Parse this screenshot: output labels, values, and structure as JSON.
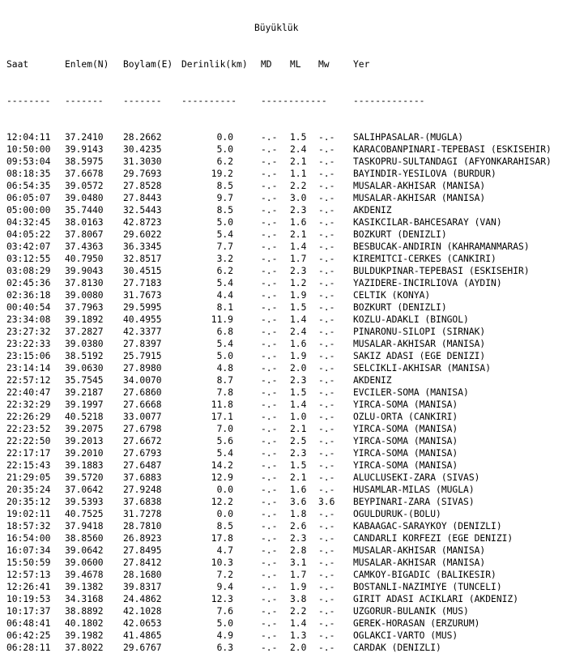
{
  "header": {
    "group_title": "Büyüklük",
    "columns": {
      "saat": "Saat",
      "enlem": "Enlem(N)",
      "boylam": "Boylam(E)",
      "derinlik": "Derinlik(km)",
      "md": "MD",
      "ml": "ML",
      "mw": "Mw",
      "yer": "Yer"
    },
    "dashes": {
      "saat": "--------",
      "enlem": "-------",
      "boylam": "-------",
      "derinlik": "----------",
      "mag": "------------",
      "yer": "-------------"
    }
  },
  "rows": [
    {
      "saat": "12:04:11",
      "enlem": "37.2410",
      "boylam": "28.2662",
      "derinlik": "0.0",
      "md": "-.-",
      "ml": "1.5",
      "mw": "-.-",
      "yer": "SALIHPASALAR-(MUGLA)"
    },
    {
      "saat": "10:50:00",
      "enlem": "39.9143",
      "boylam": "30.4235",
      "derinlik": "5.0",
      "md": "-.-",
      "ml": "2.4",
      "mw": "-.-",
      "yer": "KARACOBANPINARI-TEPEBASI (ESKISEHIR)"
    },
    {
      "saat": "09:53:04",
      "enlem": "38.5975",
      "boylam": "31.3030",
      "derinlik": "6.2",
      "md": "-.-",
      "ml": "2.1",
      "mw": "-.-",
      "yer": "TASKOPRU-SULTANDAGI (AFYONKARAHISAR)"
    },
    {
      "saat": "08:18:35",
      "enlem": "37.6678",
      "boylam": "29.7693",
      "derinlik": "19.2",
      "md": "-.-",
      "ml": "1.1",
      "mw": "-.-",
      "yer": "BAYINDIR-YESILOVA (BURDUR)"
    },
    {
      "saat": "06:54:35",
      "enlem": "39.0572",
      "boylam": "27.8528",
      "derinlik": "8.5",
      "md": "-.-",
      "ml": "2.2",
      "mw": "-.-",
      "yer": "MUSALAR-AKHISAR (MANISA)"
    },
    {
      "saat": "06:05:07",
      "enlem": "39.0480",
      "boylam": "27.8443",
      "derinlik": "9.7",
      "md": "-.-",
      "ml": "3.0",
      "mw": "-.-",
      "yer": "MUSALAR-AKHISAR (MANISA)"
    },
    {
      "saat": "05:00:00",
      "enlem": "35.7440",
      "boylam": "32.5443",
      "derinlik": "8.5",
      "md": "-.-",
      "ml": "2.3",
      "mw": "-.-",
      "yer": "AKDENIZ"
    },
    {
      "saat": "04:32:45",
      "enlem": "38.0163",
      "boylam": "42.8723",
      "derinlik": "5.0",
      "md": "-.-",
      "ml": "1.6",
      "mw": "-.-",
      "yer": "KASIKCILAR-BAHCESARAY (VAN)"
    },
    {
      "saat": "04:05:22",
      "enlem": "37.8067",
      "boylam": "29.6022",
      "derinlik": "5.4",
      "md": "-.-",
      "ml": "2.1",
      "mw": "-.-",
      "yer": "BOZKURT (DENIZLI)"
    },
    {
      "saat": "03:42:07",
      "enlem": "37.4363",
      "boylam": "36.3345",
      "derinlik": "7.7",
      "md": "-.-",
      "ml": "1.4",
      "mw": "-.-",
      "yer": "BESBUCAK-ANDIRIN (KAHRAMANMARAS)"
    },
    {
      "saat": "03:12:55",
      "enlem": "40.7950",
      "boylam": "32.8517",
      "derinlik": "3.2",
      "md": "-.-",
      "ml": "1.7",
      "mw": "-.-",
      "yer": "KIREMITCI-CERKES (CANKIRI)"
    },
    {
      "saat": "03:08:29",
      "enlem": "39.9043",
      "boylam": "30.4515",
      "derinlik": "6.2",
      "md": "-.-",
      "ml": "2.3",
      "mw": "-.-",
      "yer": "BULDUKPINAR-TEPEBASI (ESKISEHIR)"
    },
    {
      "saat": "02:45:36",
      "enlem": "37.8130",
      "boylam": "27.7183",
      "derinlik": "5.4",
      "md": "-.-",
      "ml": "1.2",
      "mw": "-.-",
      "yer": "YAZIDERE-INCIRLIOVA (AYDIN)"
    },
    {
      "saat": "02:36:18",
      "enlem": "39.0080",
      "boylam": "31.7673",
      "derinlik": "4.4",
      "md": "-.-",
      "ml": "1.9",
      "mw": "-.-",
      "yer": "CELTIK (KONYA)"
    },
    {
      "saat": "00:40:54",
      "enlem": "37.7963",
      "boylam": "29.5995",
      "derinlik": "8.1",
      "md": "-.-",
      "ml": "1.5",
      "mw": "-.-",
      "yer": "BOZKURT (DENIZLI)"
    },
    {
      "saat": "23:34:08",
      "enlem": "39.1892",
      "boylam": "40.4955",
      "derinlik": "11.9",
      "md": "-.-",
      "ml": "1.4",
      "mw": "-.-",
      "yer": "KOZLU-ADAKLI (BINGOL)"
    },
    {
      "saat": "23:27:32",
      "enlem": "37.2827",
      "boylam": "42.3377",
      "derinlik": "6.8",
      "md": "-.-",
      "ml": "2.4",
      "mw": "-.-",
      "yer": "PINARONU-SILOPI (SIRNAK)"
    },
    {
      "saat": "23:22:33",
      "enlem": "39.0380",
      "boylam": "27.8397",
      "derinlik": "5.4",
      "md": "-.-",
      "ml": "1.6",
      "mw": "-.-",
      "yer": "MUSALAR-AKHISAR (MANISA)"
    },
    {
      "saat": "23:15:06",
      "enlem": "38.5192",
      "boylam": "25.7915",
      "derinlik": "5.0",
      "md": "-.-",
      "ml": "1.9",
      "mw": "-.-",
      "yer": "SAKIZ ADASI (EGE DENIZI)"
    },
    {
      "saat": "23:14:14",
      "enlem": "39.0630",
      "boylam": "27.8980",
      "derinlik": "4.8",
      "md": "-.-",
      "ml": "2.0",
      "mw": "-.-",
      "yer": "SELCIKLI-AKHISAR (MANISA)"
    },
    {
      "saat": "22:57:12",
      "enlem": "35.7545",
      "boylam": "34.0070",
      "derinlik": "8.7",
      "md": "-.-",
      "ml": "2.3",
      "mw": "-.-",
      "yer": "AKDENIZ"
    },
    {
      "saat": "22:40:47",
      "enlem": "39.2187",
      "boylam": "27.6860",
      "derinlik": "7.8",
      "md": "-.-",
      "ml": "1.5",
      "mw": "-.-",
      "yer": "EVCILER-SOMA (MANISA)"
    },
    {
      "saat": "22:32:29",
      "enlem": "39.1997",
      "boylam": "27.6668",
      "derinlik": "11.8",
      "md": "-.-",
      "ml": "1.4",
      "mw": "-.-",
      "yer": "YIRCA-SOMA (MANISA)"
    },
    {
      "saat": "22:26:29",
      "enlem": "40.5218",
      "boylam": "33.0077",
      "derinlik": "17.1",
      "md": "-.-",
      "ml": "1.0",
      "mw": "-.-",
      "yer": "OZLU-ORTA (CANKIRI)"
    },
    {
      "saat": "22:23:52",
      "enlem": "39.2075",
      "boylam": "27.6798",
      "derinlik": "7.0",
      "md": "-.-",
      "ml": "2.1",
      "mw": "-.-",
      "yer": "YIRCA-SOMA (MANISA)"
    },
    {
      "saat": "22:22:50",
      "enlem": "39.2013",
      "boylam": "27.6672",
      "derinlik": "5.6",
      "md": "-.-",
      "ml": "2.5",
      "mw": "-.-",
      "yer": "YIRCA-SOMA (MANISA)"
    },
    {
      "saat": "22:17:17",
      "enlem": "39.2010",
      "boylam": "27.6793",
      "derinlik": "5.4",
      "md": "-.-",
      "ml": "2.3",
      "mw": "-.-",
      "yer": "YIRCA-SOMA (MANISA)"
    },
    {
      "saat": "22:15:43",
      "enlem": "39.1883",
      "boylam": "27.6487",
      "derinlik": "14.2",
      "md": "-.-",
      "ml": "1.5",
      "mw": "-.-",
      "yer": "YIRCA-SOMA (MANISA)"
    },
    {
      "saat": "21:29:05",
      "enlem": "39.5720",
      "boylam": "37.6883",
      "derinlik": "12.9",
      "md": "-.-",
      "ml": "2.1",
      "mw": "-.-",
      "yer": "ALUCLUSEKI-ZARA (SIVAS)"
    },
    {
      "saat": "20:35:24",
      "enlem": "37.0642",
      "boylam": "27.9248",
      "derinlik": "0.0",
      "md": "-.-",
      "ml": "1.6",
      "mw": "-.-",
      "yer": "HUSAMLAR-MILAS (MUGLA)"
    },
    {
      "saat": "20:35:12",
      "enlem": "39.5393",
      "boylam": "37.6838",
      "derinlik": "12.2",
      "md": "-.-",
      "ml": "3.6",
      "mw": "3.6",
      "yer": "BEYPINARI-ZARA (SIVAS)"
    },
    {
      "saat": "19:02:11",
      "enlem": "40.7525",
      "boylam": "31.7278",
      "derinlik": "0.0",
      "md": "-.-",
      "ml": "1.8",
      "mw": "-.-",
      "yer": "OGULDURUK-(BOLU)"
    },
    {
      "saat": "18:57:32",
      "enlem": "37.9418",
      "boylam": "28.7810",
      "derinlik": "8.5",
      "md": "-.-",
      "ml": "2.6",
      "mw": "-.-",
      "yer": "KABAAGAC-SARAYKOY (DENIZLI)"
    },
    {
      "saat": "16:54:00",
      "enlem": "38.8560",
      "boylam": "26.8923",
      "derinlik": "17.8",
      "md": "-.-",
      "ml": "2.3",
      "mw": "-.-",
      "yer": "CANDARLI KORFEZI (EGE DENIZI)"
    },
    {
      "saat": "16:07:34",
      "enlem": "39.0642",
      "boylam": "27.8495",
      "derinlik": "4.7",
      "md": "-.-",
      "ml": "2.8",
      "mw": "-.-",
      "yer": "MUSALAR-AKHISAR (MANISA)"
    },
    {
      "saat": "15:50:59",
      "enlem": "39.0600",
      "boylam": "27.8412",
      "derinlik": "10.3",
      "md": "-.-",
      "ml": "3.1",
      "mw": "-.-",
      "yer": "MUSALAR-AKHISAR (MANISA)"
    },
    {
      "saat": "12:57:13",
      "enlem": "39.4678",
      "boylam": "28.1680",
      "derinlik": "7.2",
      "md": "-.-",
      "ml": "1.7",
      "mw": "-.-",
      "yer": "CAMKOY-BIGADIC (BALIKESIR)"
    },
    {
      "saat": "12:26:41",
      "enlem": "39.1382",
      "boylam": "39.8317",
      "derinlik": "9.4",
      "md": "-.-",
      "ml": "1.9",
      "mw": "-.-",
      "yer": "BOSTANLI-NAZIMIYE (TUNCELI)"
    },
    {
      "saat": "10:19:53",
      "enlem": "34.3168",
      "boylam": "24.4862",
      "derinlik": "12.3",
      "md": "-.-",
      "ml": "3.8",
      "mw": "-.-",
      "yer": "GIRIT ADASI ACIKLARI (AKDENIZ)"
    },
    {
      "saat": "10:17:37",
      "enlem": "38.8892",
      "boylam": "42.1028",
      "derinlik": "7.6",
      "md": "-.-",
      "ml": "2.2",
      "mw": "-.-",
      "yer": "UZGORUR-BULANIK (MUS)"
    },
    {
      "saat": "06:48:41",
      "enlem": "40.1802",
      "boylam": "42.0653",
      "derinlik": "5.0",
      "md": "-.-",
      "ml": "1.4",
      "mw": "-.-",
      "yer": "GEREK-HORASAN (ERZURUM)"
    },
    {
      "saat": "06:42:25",
      "enlem": "39.1982",
      "boylam": "41.4865",
      "derinlik": "4.9",
      "md": "-.-",
      "ml": "1.3",
      "mw": "-.-",
      "yer": "OGLAKCI-VARTO (MUS)"
    },
    {
      "saat": "06:28:11",
      "enlem": "37.8022",
      "boylam": "29.6767",
      "derinlik": "6.3",
      "md": "-.-",
      "ml": "2.0",
      "mw": "-.-",
      "yer": "CARDAK (DENIZLI)"
    }
  ]
}
